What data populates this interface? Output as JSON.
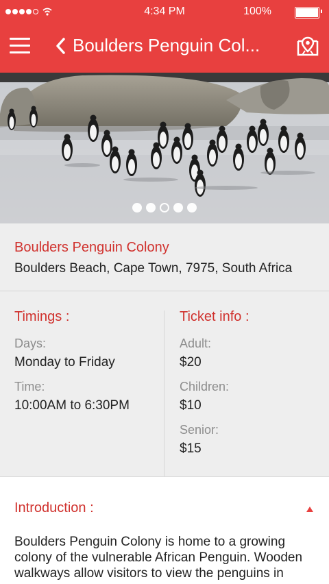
{
  "status_bar": {
    "time": "4:34 PM",
    "battery": "100%"
  },
  "header": {
    "title": "Boulders Penguin Col...",
    "menu_icon": "hamburger-icon",
    "back_icon": "chevron-left-icon",
    "map_icon": "map-pin-icon"
  },
  "gallery": {
    "pages": 5,
    "active_index": 2
  },
  "place": {
    "name": "Boulders Penguin Colony",
    "address": "Boulders Beach, Cape Town, 7975, South Africa"
  },
  "timings": {
    "title": "Timings :",
    "days_label": "Days:",
    "days_value": "Monday to Friday",
    "time_label": "Time:",
    "time_value": "10:00AM to 6:30PM"
  },
  "tickets": {
    "title": "Ticket info :",
    "adult_label": "Adult:",
    "adult_value": "$20",
    "children_label": "Children:",
    "children_value": "$10",
    "senior_label": "Senior:",
    "senior_value": "$15"
  },
  "introduction": {
    "title": "Introduction :",
    "text": "Boulders Penguin Colony is home to a growing colony of the vulnerable African Penguin. Wooden walkways allow visitors to view the penguins in"
  },
  "colors": {
    "accent": "#e8403f",
    "heading": "#d0312d",
    "muted": "#8d8d8d"
  }
}
